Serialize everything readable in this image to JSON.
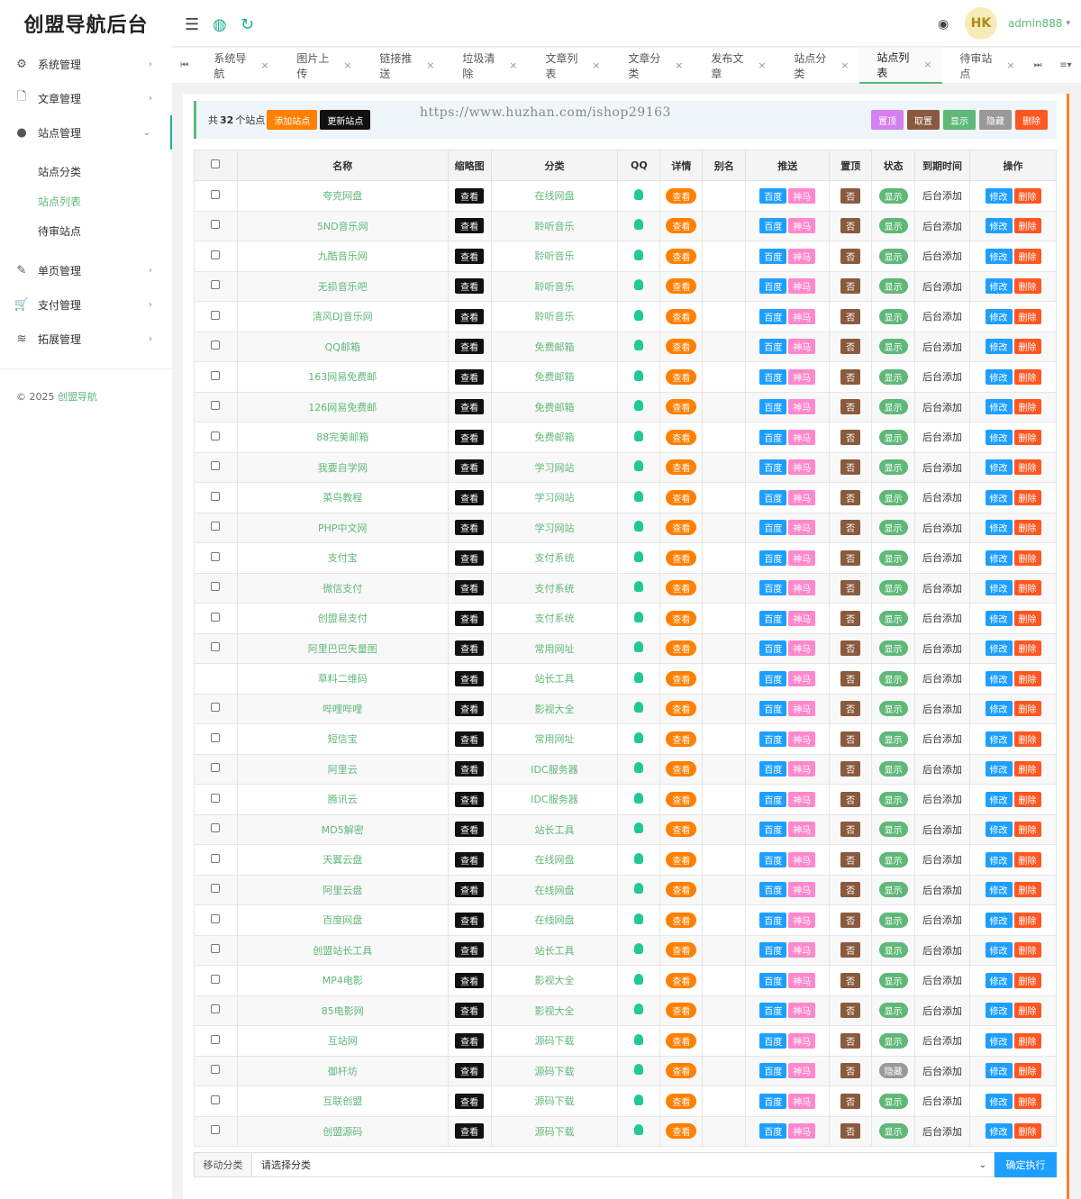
{
  "app": {
    "title": "创盟导航后台"
  },
  "sidebar": {
    "items": [
      {
        "label": "系统管理",
        "icon": "gear-icon"
      },
      {
        "label": "文章管理",
        "icon": "file-icon"
      },
      {
        "label": "站点管理",
        "icon": "compass-icon"
      },
      {
        "label": "单页管理",
        "icon": "page-edit-icon"
      },
      {
        "label": "支付管理",
        "icon": "cart-icon"
      },
      {
        "label": "拓展管理",
        "icon": "layers-icon"
      }
    ],
    "sub_items": [
      "站点分类",
      "站点列表",
      "待审站点"
    ],
    "copyright_prefix": "© 2025",
    "copyright_link": "创盟导航"
  },
  "header": {
    "username": "admin888",
    "avatar_text": "HK"
  },
  "tabs": [
    "系统导航",
    "图片上传",
    "链接推送",
    "垃圾清除",
    "文章列表",
    "文章分类",
    "发布文章",
    "站点分类",
    "站点列表",
    "待审站点"
  ],
  "toolbar": {
    "total_prefix": "共",
    "total_count": "32",
    "total_suffix": "个站点",
    "add_label": "添加站点",
    "update_label": "更新站点",
    "watermark": "https://www.huzhan.com/ishop29163",
    "top_label": "置顶",
    "untop_label": "取置",
    "show_label": "显示",
    "hide_label": "隐藏",
    "delete_label": "删除"
  },
  "table": {
    "headers": [
      "名称",
      "缩略图",
      "分类",
      "QQ",
      "详情",
      "别名",
      "推送",
      "置顶",
      "状态",
      "到期时间",
      "操作"
    ],
    "view_label": "查看",
    "push_baidu": "百度",
    "push_shenma": "神马",
    "top_value": "否",
    "expire_value": "后台添加",
    "edit_label": "修改",
    "delete_label": "删除",
    "rows": [
      {
        "name": "夸克网盘",
        "category": "在线网盘",
        "status": "显示"
      },
      {
        "name": "5ND音乐网",
        "category": "聆听音乐",
        "status": "显示"
      },
      {
        "name": "九酷音乐网",
        "category": "聆听音乐",
        "status": "显示"
      },
      {
        "name": "无损音乐吧",
        "category": "聆听音乐",
        "status": "显示"
      },
      {
        "name": "清风DJ音乐网",
        "category": "聆听音乐",
        "status": "显示"
      },
      {
        "name": "QQ邮箱",
        "category": "免费邮箱",
        "status": "显示"
      },
      {
        "name": "163网易免费邮",
        "category": "免费邮箱",
        "status": "显示"
      },
      {
        "name": "126网易免费邮",
        "category": "免费邮箱",
        "status": "显示"
      },
      {
        "name": "88完美邮箱",
        "category": "免费邮箱",
        "status": "显示"
      },
      {
        "name": "我要自学网",
        "category": "学习网站",
        "status": "显示"
      },
      {
        "name": "菜鸟教程",
        "category": "学习网站",
        "status": "显示"
      },
      {
        "name": "PHP中文网",
        "category": "学习网站",
        "status": "显示"
      },
      {
        "name": "支付宝",
        "category": "支付系统",
        "status": "显示"
      },
      {
        "name": "微信支付",
        "category": "支付系统",
        "status": "显示"
      },
      {
        "name": "创盟易支付",
        "category": "支付系统",
        "status": "显示"
      },
      {
        "name": "阿里巴巴矢量图",
        "category": "常用网址",
        "status": "显示"
      },
      {
        "name": "草料二维码",
        "category": "站长工具",
        "status": "显示",
        "no_checkbox": true
      },
      {
        "name": "哔哩哔哩",
        "category": "影视大全",
        "status": "显示"
      },
      {
        "name": "短信宝",
        "category": "常用网址",
        "status": "显示"
      },
      {
        "name": "阿里云",
        "category": "IDC服务器",
        "status": "显示"
      },
      {
        "name": "腾讯云",
        "category": "IDC服务器",
        "status": "显示"
      },
      {
        "name": "MD5解密",
        "category": "站长工具",
        "status": "显示"
      },
      {
        "name": "天翼云盘",
        "category": "在线网盘",
        "status": "显示"
      },
      {
        "name": "阿里云盘",
        "category": "在线网盘",
        "status": "显示"
      },
      {
        "name": "百度网盘",
        "category": "在线网盘",
        "status": "显示"
      },
      {
        "name": "创盟站长工具",
        "category": "站长工具",
        "status": "显示"
      },
      {
        "name": "MP4电影",
        "category": "影视大全",
        "status": "显示"
      },
      {
        "name": "85电影网",
        "category": "影视大全",
        "status": "显示"
      },
      {
        "name": "互站网",
        "category": "源码下载",
        "status": "显示"
      },
      {
        "name": "御杆坊",
        "category": "源码下载",
        "status": "隐藏"
      },
      {
        "name": "互联创盟",
        "category": "源码下载",
        "status": "显示"
      },
      {
        "name": "创盟源码",
        "category": "源码下载",
        "status": "显示"
      }
    ]
  },
  "footer": {
    "move_label": "移动分类",
    "select_placeholder": "请选择分类",
    "execute_label": "确定执行"
  },
  "colors": {
    "accent": "#5fb878",
    "blue": "#1e9fff",
    "orange": "#ff7f00",
    "delete": "#ff5722"
  }
}
